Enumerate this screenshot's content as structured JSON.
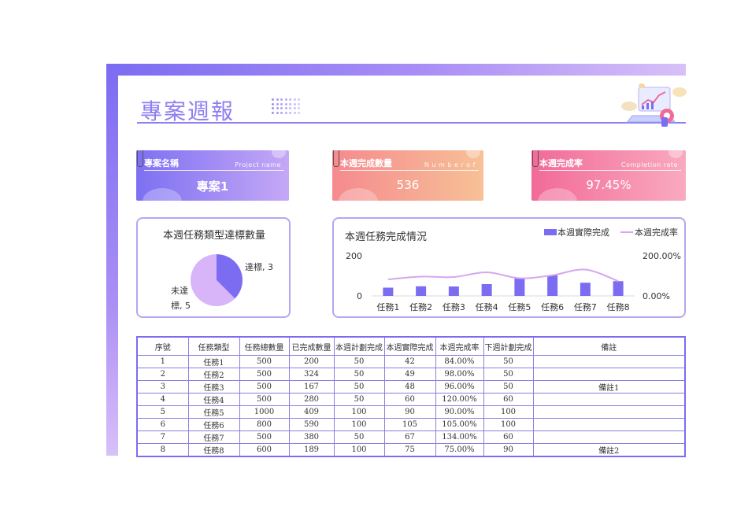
{
  "header": {
    "title": "專案週報"
  },
  "kpis": [
    {
      "label": "專案名稱",
      "sub": "Project name",
      "value": "專案1"
    },
    {
      "label": "本週完成數量",
      "sub": "N u m b e r   o f",
      "value": "536"
    },
    {
      "label": "本週完成率",
      "sub": "Completion rate",
      "value": "97.45%"
    }
  ],
  "pie_panel": {
    "title": "本週任務類型達標數量"
  },
  "bar_panel": {
    "title": "本週任務完成情況"
  },
  "chart_data": [
    {
      "type": "pie",
      "title": "本週任務類型達標數量",
      "labels": [
        "達標",
        "未達標"
      ],
      "values": [
        3,
        5
      ],
      "label_texts": [
        "達標, 3",
        "未達",
        "標, 5"
      ],
      "colors": [
        "#7b6cf2",
        "#d8b4f8"
      ]
    },
    {
      "type": "bar",
      "title": "本週任務完成情況",
      "categories": [
        "任務1",
        "任務2",
        "任務3",
        "任務4",
        "任務5",
        "任務6",
        "任務7",
        "任務8"
      ],
      "series": [
        {
          "name": "本週實際完成",
          "type": "bar",
          "values": [
            42,
            49,
            48,
            60,
            90,
            105,
            67,
            75
          ],
          "color": "#7b6cf2"
        },
        {
          "name": "本週完成率",
          "type": "line",
          "values": [
            84.0,
            98.0,
            96.0,
            120.0,
            90.0,
            105.0,
            134.0,
            75.0
          ],
          "color": "#d7a6ef"
        }
      ],
      "y_left": {
        "ticks": [
          "0",
          "200"
        ],
        "range": [
          0,
          200
        ]
      },
      "y_right": {
        "ticks": [
          "0.00%",
          "200.00%"
        ],
        "range": [
          0,
          200
        ]
      },
      "legend_position": "top-right"
    }
  ],
  "table": {
    "headers": [
      "序號",
      "任務類型",
      "任務總數量",
      "已完成數量",
      "本週計劃完成",
      "本週實際完成",
      "本週完成率",
      "下週計劃完成",
      "備註"
    ],
    "rows": [
      [
        "1",
        "任務1",
        "500",
        "200",
        "50",
        "42",
        "84.00%",
        "50",
        ""
      ],
      [
        "2",
        "任務2",
        "500",
        "324",
        "50",
        "49",
        "98.00%",
        "50",
        ""
      ],
      [
        "3",
        "任務3",
        "500",
        "167",
        "50",
        "48",
        "96.00%",
        "50",
        "備註1"
      ],
      [
        "4",
        "任務4",
        "500",
        "280",
        "50",
        "60",
        "120.00%",
        "60",
        ""
      ],
      [
        "5",
        "任務5",
        "1000",
        "409",
        "100",
        "90",
        "90.00%",
        "100",
        ""
      ],
      [
        "6",
        "任務6",
        "800",
        "590",
        "100",
        "105",
        "105.00%",
        "100",
        ""
      ],
      [
        "7",
        "任務7",
        "500",
        "380",
        "50",
        "67",
        "134.00%",
        "60",
        ""
      ],
      [
        "8",
        "任務8",
        "600",
        "189",
        "100",
        "75",
        "75.00%",
        "90",
        "備註2"
      ]
    ]
  }
}
